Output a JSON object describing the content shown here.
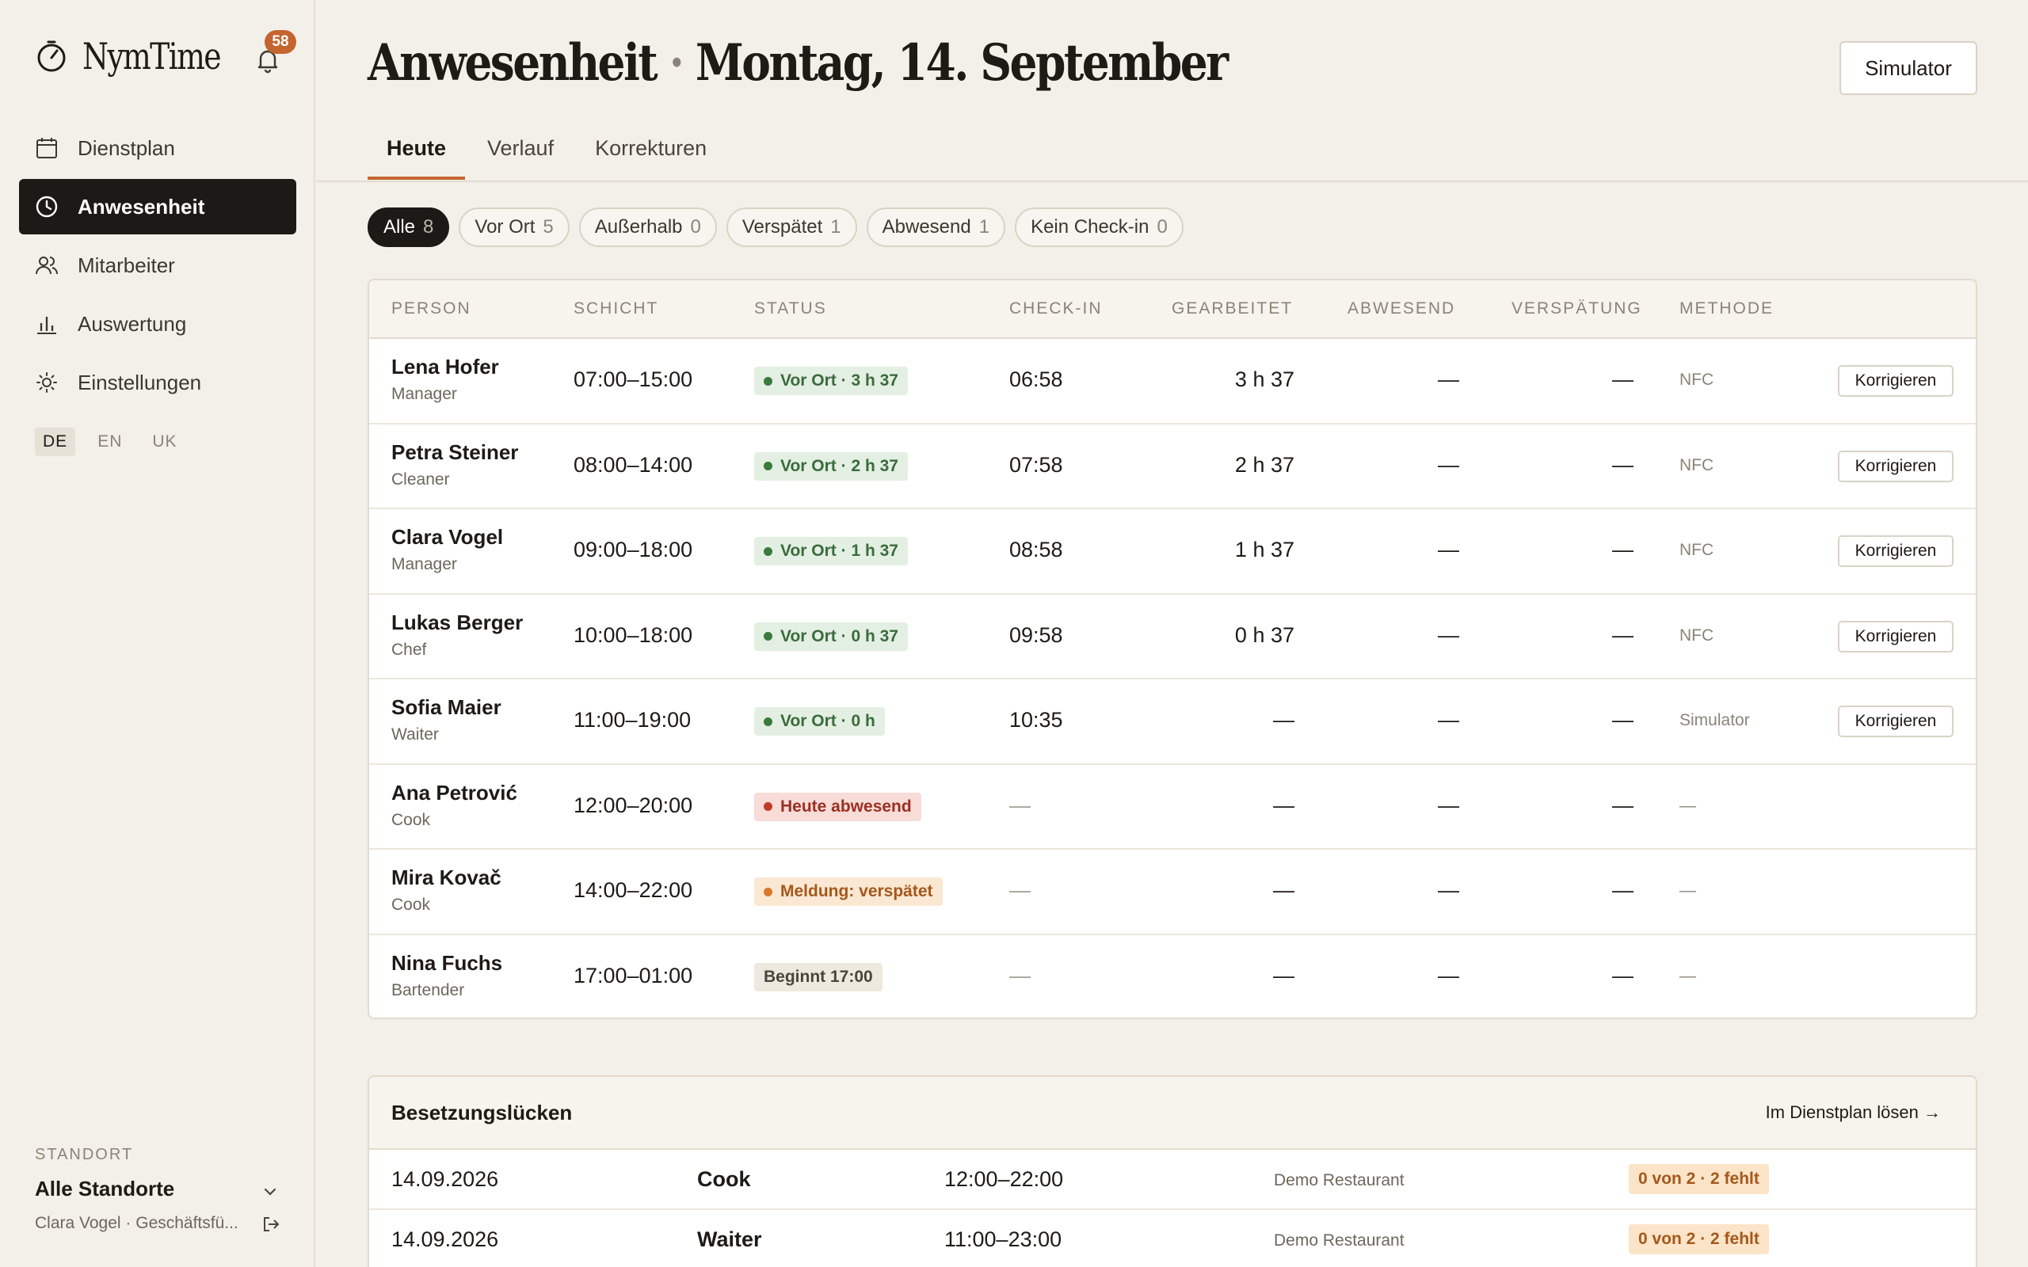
{
  "app": {
    "name": "NymTime",
    "notifications": "58"
  },
  "sidebar": {
    "items": [
      {
        "label": "Dienstplan",
        "icon": "calendar-icon"
      },
      {
        "label": "Anwesenheit",
        "icon": "clock-icon",
        "active": true
      },
      {
        "label": "Mitarbeiter",
        "icon": "users-icon"
      },
      {
        "label": "Auswertung",
        "icon": "bar-chart-icon"
      },
      {
        "label": "Einstellungen",
        "icon": "gear-icon"
      }
    ],
    "languages": [
      "DE",
      "EN",
      "UK"
    ],
    "active_language": "DE",
    "standort_label": "STANDORT",
    "standort_value": "Alle Standorte",
    "user": "Clara Vogel · Geschäftsfü..."
  },
  "header": {
    "title_part1": "Anwesenheit",
    "title_sep": "·",
    "title_part2": "Montag, 14. September",
    "simulator_label": "Simulator"
  },
  "tabs": [
    "Heute",
    "Verlauf",
    "Korrekturen"
  ],
  "filters": [
    {
      "label": "Alle",
      "count": "8",
      "active": true
    },
    {
      "label": "Vor Ort",
      "count": "5"
    },
    {
      "label": "Außerhalb",
      "count": "0"
    },
    {
      "label": "Verspätet",
      "count": "1"
    },
    {
      "label": "Abwesend",
      "count": "1"
    },
    {
      "label": "Kein Check-in",
      "count": "0"
    }
  ],
  "table": {
    "headers": [
      "PERSON",
      "SCHICHT",
      "STATUS",
      "CHECK-IN",
      "GEARBEITET",
      "ABWESEND",
      "VERSPÄTUNG",
      "METHODE"
    ],
    "correct_label": "Korrigieren",
    "rows": [
      {
        "name": "Lena Hofer",
        "role": "Manager",
        "shift": "07:00–15:00",
        "status": "Vor Ort · 3 h 37",
        "status_type": "green",
        "checkin": "06:58",
        "worked": "3 h 37",
        "absent": "—",
        "late": "—",
        "method": "NFC",
        "correctable": true
      },
      {
        "name": "Petra Steiner",
        "role": "Cleaner",
        "shift": "08:00–14:00",
        "status": "Vor Ort · 2 h 37",
        "status_type": "green",
        "checkin": "07:58",
        "worked": "2 h 37",
        "absent": "—",
        "late": "—",
        "method": "NFC",
        "correctable": true
      },
      {
        "name": "Clara Vogel",
        "role": "Manager",
        "shift": "09:00–18:00",
        "status": "Vor Ort · 1 h 37",
        "status_type": "green",
        "checkin": "08:58",
        "worked": "1 h 37",
        "absent": "—",
        "late": "—",
        "method": "NFC",
        "correctable": true
      },
      {
        "name": "Lukas Berger",
        "role": "Chef",
        "shift": "10:00–18:00",
        "status": "Vor Ort · 0 h 37",
        "status_type": "green",
        "checkin": "09:58",
        "worked": "0 h 37",
        "absent": "—",
        "late": "—",
        "method": "NFC",
        "correctable": true
      },
      {
        "name": "Sofia Maier",
        "role": "Waiter",
        "shift": "11:00–19:00",
        "status": "Vor Ort · 0 h",
        "status_type": "green",
        "checkin": "10:35",
        "worked": "—",
        "absent": "—",
        "late": "—",
        "method": "Simulator",
        "correctable": true
      },
      {
        "name": "Ana Petrović",
        "role": "Cook",
        "shift": "12:00–20:00",
        "status": "Heute abwesend",
        "status_type": "red",
        "checkin": "—",
        "worked": "—",
        "absent": "—",
        "late": "—",
        "method": "—",
        "correctable": false
      },
      {
        "name": "Mira Kovač",
        "role": "Cook",
        "shift": "14:00–22:00",
        "status": "Meldung: verspätet",
        "status_type": "orange",
        "checkin": "—",
        "worked": "—",
        "absent": "—",
        "late": "—",
        "method": "—",
        "correctable": false
      },
      {
        "name": "Nina Fuchs",
        "role": "Bartender",
        "shift": "17:00–01:00",
        "status": "Beginnt 17:00",
        "status_type": "neutral",
        "checkin": "—",
        "worked": "—",
        "absent": "—",
        "late": "—",
        "method": "—",
        "correctable": false
      }
    ]
  },
  "gaps": {
    "title": "Besetzungslücken",
    "link": "Im Dienstplan lösen →",
    "rows": [
      {
        "date": "14.09.2026",
        "role": "Cook",
        "time": "12:00–22:00",
        "location": "Demo Restaurant",
        "badge": "0 von 2 · 2 fehlt"
      },
      {
        "date": "14.09.2026",
        "role": "Waiter",
        "time": "11:00–23:00",
        "location": "Demo Restaurant",
        "badge": "0 von 2 · 2 fehlt"
      }
    ]
  },
  "colors": {
    "accent": "#c4652f",
    "dark": "#1c1a17",
    "background": "#f3f0e9",
    "green": "#3a7a3e",
    "red": "#c13b2b",
    "orange": "#d9782a"
  }
}
